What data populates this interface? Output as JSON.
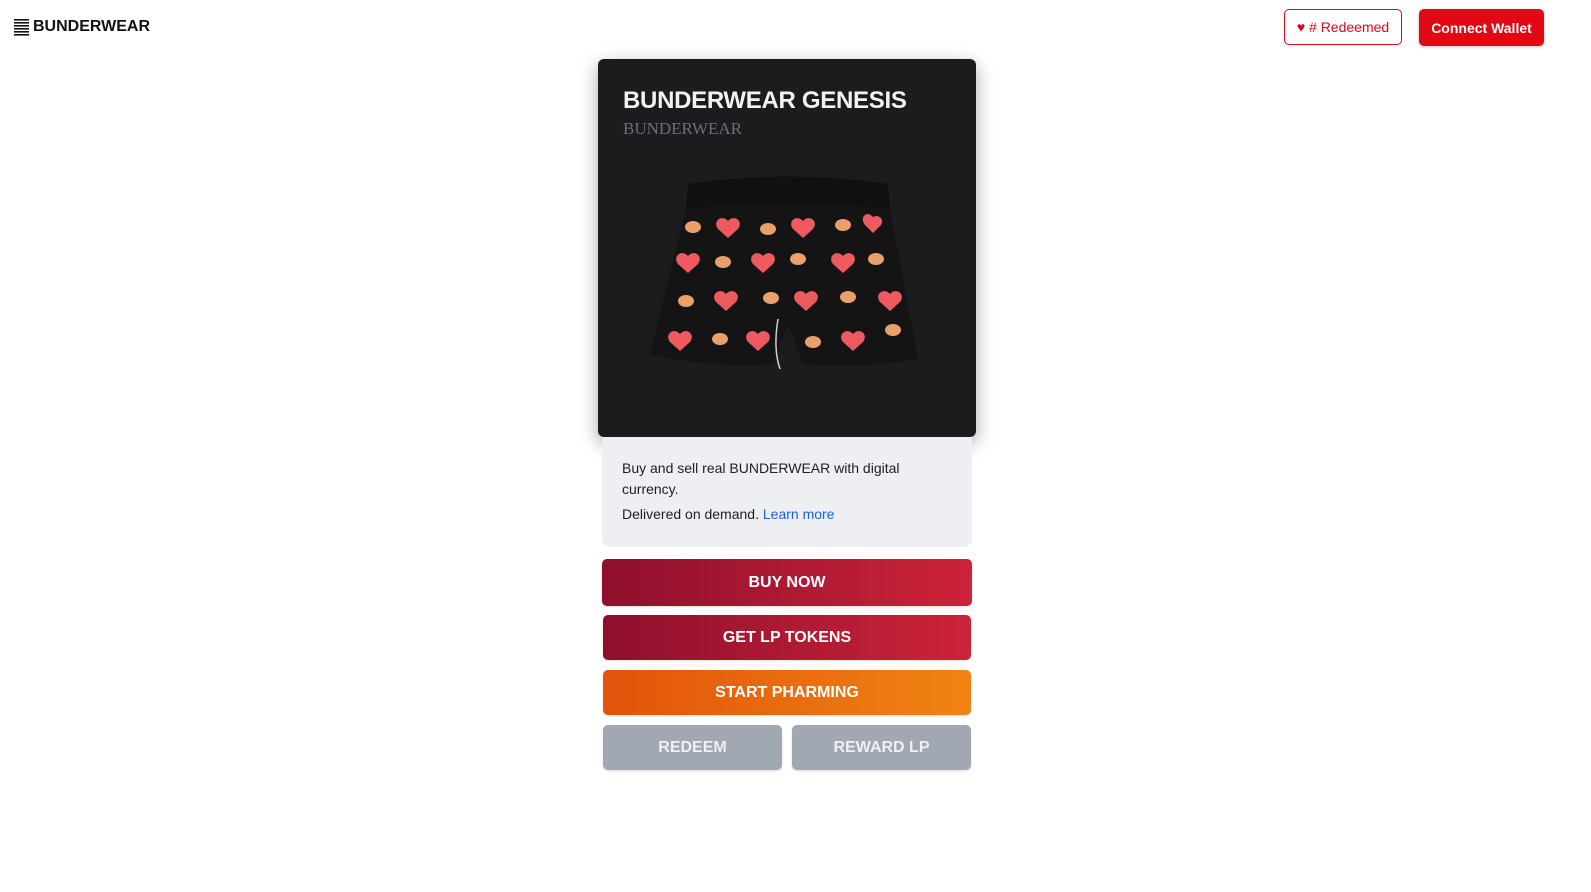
{
  "header": {
    "brand": "BUNDERWEAR",
    "redeemed_label": "♥ # Redeemed",
    "connect_label": "Connect Wallet"
  },
  "card": {
    "title": "BUNDERWEAR GENESIS",
    "subtitle": "BUNDERWEAR"
  },
  "description": {
    "line1": "Buy and sell real BUNDERWEAR with digital currency.",
    "line2": "Delivered on demand.",
    "link": "Learn more"
  },
  "actions": {
    "buy": "BUY NOW",
    "lp": "GET LP TOKENS",
    "pharm": "START PHARMING",
    "redeem": "REDEEM",
    "reward": "REWARD LP"
  },
  "colors": {
    "brand_red": "#e30613",
    "card_bg": "#1c1b1d",
    "disabled_grey": "#a1a8b1"
  }
}
